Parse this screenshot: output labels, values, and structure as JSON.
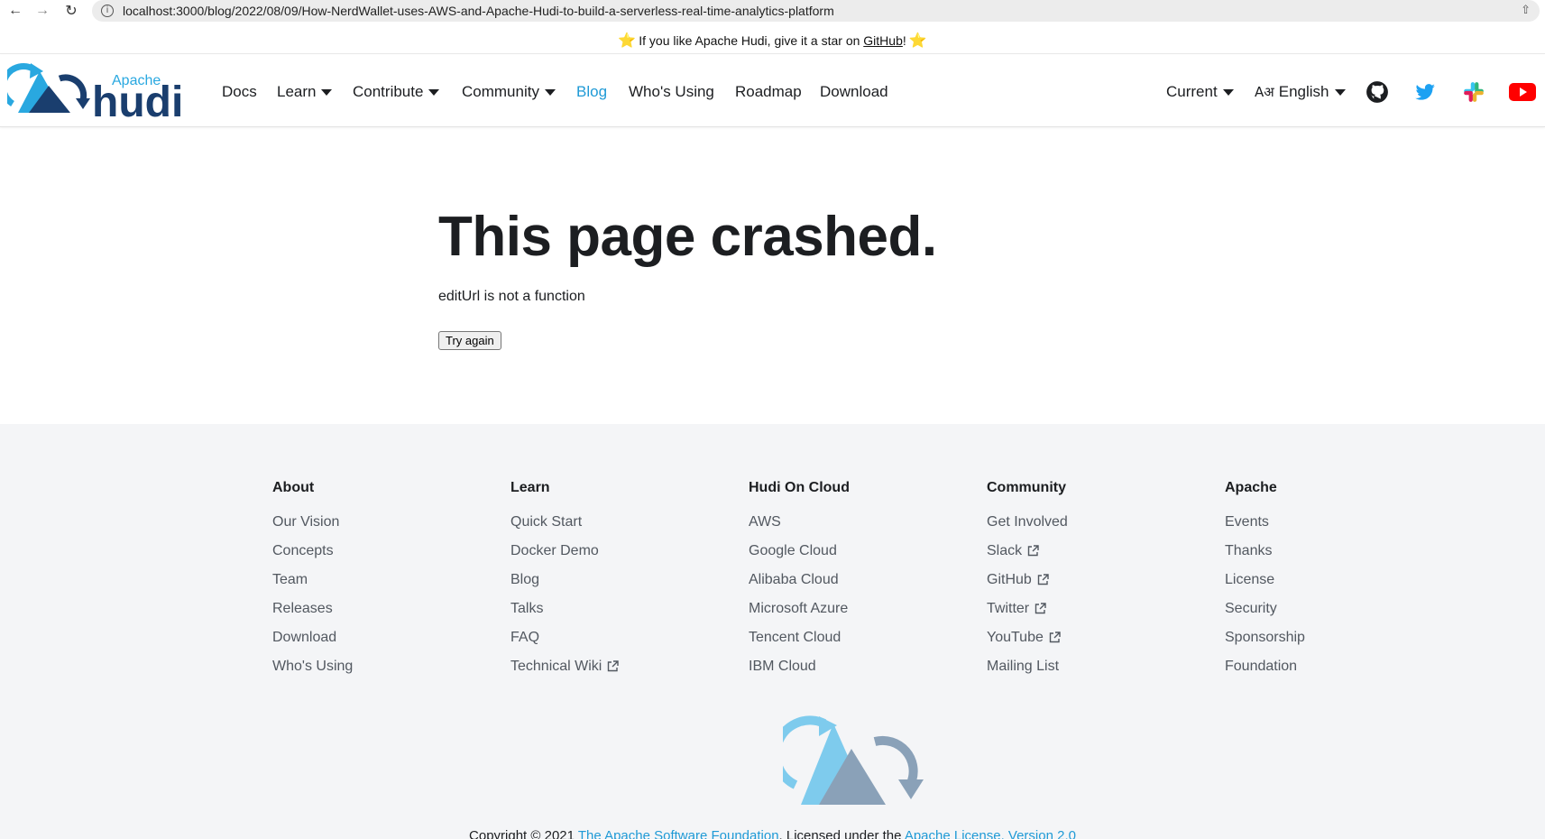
{
  "browser": {
    "url": "localhost:3000/blog/2022/08/09/How-NerdWallet-uses-AWS-and-Apache-Hudi-to-build-a-serverless-real-time-analytics-platform"
  },
  "announcement": {
    "prefix": "If you like Apache Hudi, give it a star on ",
    "link": "GitHub",
    "suffix": "!"
  },
  "logo": {
    "small_text": "Apache",
    "big_text": "hudi"
  },
  "nav": {
    "docs": "Docs",
    "learn": "Learn",
    "contribute": "Contribute",
    "community": "Community",
    "blog": "Blog",
    "whos_using": "Who's Using",
    "roadmap": "Roadmap",
    "download": "Download",
    "version": "Current",
    "language": "English",
    "language_glyph": "Aअ"
  },
  "crash": {
    "title": "This page crashed.",
    "message": "editUrl is not a function",
    "button": "Try again"
  },
  "footer": {
    "columns": [
      {
        "title": "About",
        "links": [
          "Our Vision",
          "Concepts",
          "Team",
          "Releases",
          "Download",
          "Who's Using"
        ]
      },
      {
        "title": "Learn",
        "links": [
          "Quick Start",
          "Docker Demo",
          "Blog",
          "Talks",
          "FAQ",
          "Technical Wiki"
        ]
      },
      {
        "title": "Hudi On Cloud",
        "links": [
          "AWS",
          "Google Cloud",
          "Alibaba Cloud",
          "Microsoft Azure",
          "Tencent Cloud",
          "IBM Cloud"
        ]
      },
      {
        "title": "Community",
        "links": [
          "Get Involved",
          "Slack",
          "GitHub",
          "Twitter",
          "YouTube",
          "Mailing List"
        ]
      },
      {
        "title": "Apache",
        "links": [
          "Events",
          "Thanks",
          "License",
          "Security",
          "Sponsorship",
          "Foundation"
        ]
      }
    ],
    "copyright_prefix": "Copyright © 2021 ",
    "copyright_link1": "The Apache Software Foundation",
    "copyright_mid": ", Licensed under the ",
    "copyright_link2": "Apache License, Version 2.0"
  },
  "colors": {
    "accent": "#1f9ad6",
    "footer_bg": "#f4f5f7",
    "logo_dark": "#1a3e6e",
    "logo_light": "#29a8e0"
  }
}
